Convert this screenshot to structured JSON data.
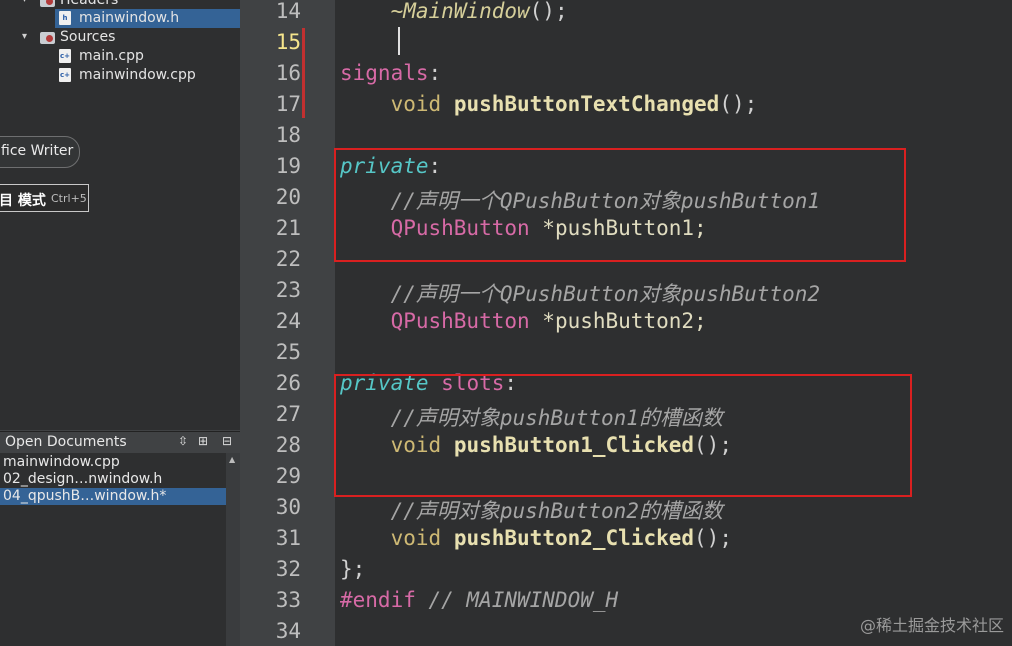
{
  "project_tree": {
    "headers_label": "Headers",
    "headers_file": "mainwindow.h",
    "sources_label": "Sources",
    "sources_files": [
      "main.cpp",
      "mainwindow.cpp"
    ]
  },
  "mode_pill": {
    "label": "fice Writer"
  },
  "mode_tooltip": {
    "label": "目 模式",
    "shortcut": "Ctrl+5"
  },
  "open_documents": {
    "title": "Open Documents",
    "items": [
      "mainwindow.cpp",
      "02_design…nwindow.h",
      "04_qpushB…window.h*"
    ]
  },
  "editor": {
    "current_line": "15",
    "lines": [
      {
        "n": "14",
        "tokens": [
          {
            "t": "    "
          },
          {
            "t": "~MainWindow",
            "c": "#d6cf9a",
            "i": true
          },
          {
            "t": "();",
            "c": "#d0d0d0"
          }
        ]
      },
      {
        "n": "15",
        "tokens": [
          {
            "t": ""
          }
        ]
      },
      {
        "n": "16",
        "tokens": [
          {
            "t": "signals",
            "c": "#d76aa6"
          },
          {
            "t": ":",
            "c": "#d0d0d0"
          }
        ]
      },
      {
        "n": "17",
        "tokens": [
          {
            "t": "    "
          },
          {
            "t": "void",
            "c": "#ceb974"
          },
          {
            "t": " "
          },
          {
            "t": "pushButtonTextChanged",
            "c": "#e8e0b0",
            "b": true
          },
          {
            "t": "();",
            "c": "#d0d0d0"
          }
        ]
      },
      {
        "n": "18",
        "tokens": [
          {
            "t": ""
          }
        ]
      },
      {
        "n": "19",
        "tokens": [
          {
            "t": "private",
            "c": "#56c7c7",
            "i": true
          },
          {
            "t": ":",
            "c": "#d0d0d0"
          }
        ]
      },
      {
        "n": "20",
        "tokens": [
          {
            "t": "    "
          },
          {
            "t": "//声明一个QPushButton对象pushButton1",
            "c": "#a5a5a5",
            "i": true
          }
        ]
      },
      {
        "n": "21",
        "tokens": [
          {
            "t": "    "
          },
          {
            "t": "QPushButton",
            "c": "#d76aa6"
          },
          {
            "t": " *pushButton1;",
            "c": "#e0dcc0"
          }
        ]
      },
      {
        "n": "22",
        "tokens": [
          {
            "t": ""
          }
        ]
      },
      {
        "n": "23",
        "tokens": [
          {
            "t": "    "
          },
          {
            "t": "//声明一个QPushButton对象pushButton2",
            "c": "#a5a5a5",
            "i": true
          }
        ]
      },
      {
        "n": "24",
        "tokens": [
          {
            "t": "    "
          },
          {
            "t": "QPushButton",
            "c": "#d76aa6"
          },
          {
            "t": " *pushButton2;",
            "c": "#e0dcc0"
          }
        ]
      },
      {
        "n": "25",
        "tokens": [
          {
            "t": ""
          }
        ]
      },
      {
        "n": "26",
        "tokens": [
          {
            "t": "private",
            "c": "#56c7c7",
            "i": true
          },
          {
            "t": " "
          },
          {
            "t": "slots",
            "c": "#d76aa6"
          },
          {
            "t": ":",
            "c": "#d0d0d0"
          }
        ]
      },
      {
        "n": "27",
        "tokens": [
          {
            "t": "    "
          },
          {
            "t": "//声明对象pushButton1的槽函数",
            "c": "#a5a5a5",
            "i": true
          }
        ]
      },
      {
        "n": "28",
        "tokens": [
          {
            "t": "    "
          },
          {
            "t": "void",
            "c": "#ceb974"
          },
          {
            "t": " "
          },
          {
            "t": "pushButton1_Clicked",
            "c": "#e8e0b0",
            "b": true
          },
          {
            "t": "();",
            "c": "#d0d0d0"
          }
        ]
      },
      {
        "n": "29",
        "tokens": [
          {
            "t": ""
          }
        ]
      },
      {
        "n": "30",
        "tokens": [
          {
            "t": "    "
          },
          {
            "t": "//声明对象pushButton2的槽函数",
            "c": "#a5a5a5",
            "i": true
          }
        ]
      },
      {
        "n": "31",
        "tokens": [
          {
            "t": "    "
          },
          {
            "t": "void",
            "c": "#ceb974"
          },
          {
            "t": " "
          },
          {
            "t": "pushButton2_Clicked",
            "c": "#e8e0b0",
            "b": true
          },
          {
            "t": "();",
            "c": "#d0d0d0"
          }
        ]
      },
      {
        "n": "32",
        "tokens": [
          {
            "t": "};",
            "c": "#d0d0d0"
          }
        ]
      },
      {
        "n": "33",
        "tokens": [
          {
            "t": "#endif",
            "c": "#d76aa6"
          },
          {
            "t": " // MAINWINDOW_H",
            "c": "#a5a5a5",
            "i": true
          }
        ]
      },
      {
        "n": "34",
        "tokens": [
          {
            "t": ""
          }
        ]
      }
    ]
  },
  "watermark": "@稀土掘金技术社区",
  "colors": {
    "selection": "#346396",
    "highlight_box": "#d92020",
    "editor_bg": "#2e2f30",
    "gutter_bg": "#404244"
  }
}
